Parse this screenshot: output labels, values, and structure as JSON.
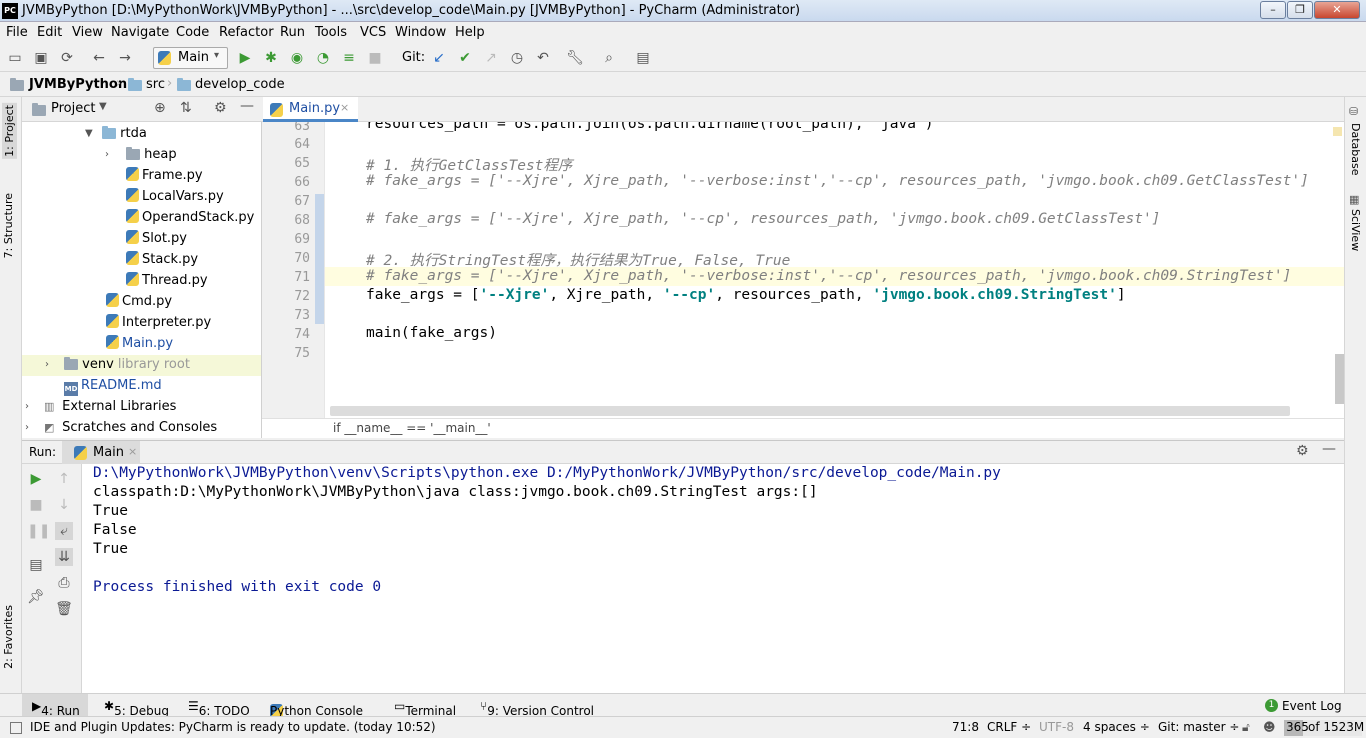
{
  "window": {
    "title": "JVMByPython [D:\\MyPythonWork\\JVMByPython] - ...\\src\\develop_code\\Main.py [JVMByPython] - PyCharm (Administrator)",
    "app_badge": "PC",
    "minimize": "–",
    "maximize": "❐",
    "close": "✕"
  },
  "menu": [
    "File",
    "Edit",
    "View",
    "Navigate",
    "Code",
    "Refactor",
    "Run",
    "Tools",
    "VCS",
    "Window",
    "Help"
  ],
  "toolbar": {
    "run_config": "Main",
    "git_label": "Git:"
  },
  "breadcrumb": [
    "JVMByPython",
    "src",
    "develop_code"
  ],
  "left_tabs": {
    "project": "1: Project",
    "structure": "7: Structure",
    "favorites": "2: Favorites"
  },
  "right_tabs": {
    "database": "Database",
    "sciview": "SciView"
  },
  "project_panel": {
    "title": "Project",
    "tree": [
      {
        "label": "rtda"
      },
      {
        "label": "heap"
      },
      {
        "label": "Frame.py"
      },
      {
        "label": "LocalVars.py"
      },
      {
        "label": "OperandStack.py"
      },
      {
        "label": "Slot.py"
      },
      {
        "label": "Stack.py"
      },
      {
        "label": "Thread.py"
      },
      {
        "label": "Cmd.py"
      },
      {
        "label": "Interpreter.py"
      },
      {
        "label": "Main.py"
      },
      {
        "label": "venv",
        "hint": "library root"
      },
      {
        "label": "README.md",
        "badge": "MD"
      },
      {
        "label": "External Libraries"
      },
      {
        "label": "Scratches and Consoles"
      }
    ]
  },
  "editor": {
    "tab": "Main.py",
    "lines": [
      {
        "num": "63",
        "text": "resources_path = os.path.join(os.path.dirname(root_path), 'java')"
      },
      {
        "num": "64",
        "text": ""
      },
      {
        "num": "65",
        "text": "# 1. 执行GetClassTest程序"
      },
      {
        "num": "66",
        "text": "# fake_args = ['--Xjre', Xjre_path, '--verbose:inst','--cp', resources_path, 'jvmgo.book.ch09.GetClassTest']"
      },
      {
        "num": "67",
        "text": ""
      },
      {
        "num": "68",
        "text": "# fake_args = ['--Xjre', Xjre_path, '--cp', resources_path, 'jvmgo.book.ch09.GetClassTest']"
      },
      {
        "num": "69",
        "text": ""
      },
      {
        "num": "70",
        "text": "# 2. 执行StringTest程序，执行结果为True, False, True"
      },
      {
        "num": "71",
        "text": "# fake_args = ['--Xjre', Xjre_path, '--verbose:inst','--cp', resources_path, 'jvmgo.book.ch09.StringTest']"
      },
      {
        "num": "72",
        "pre": "fake_args = [",
        "s1": "'--Xjre'",
        "mid1": ", Xjre_path, ",
        "s2": "'--cp'",
        "mid2": ", resources_path, ",
        "s3": "'jvmgo.book.ch09.StringTest'",
        "post": "]"
      },
      {
        "num": "73",
        "text": ""
      },
      {
        "num": "74",
        "text": "main(fake_args)"
      },
      {
        "num": "75",
        "text": ""
      }
    ],
    "breadcrumb": "if __name__ == '__main__'"
  },
  "run_panel": {
    "label": "Run:",
    "tab": "Main",
    "output": [
      "D:\\MyPythonWork\\JVMByPython\\venv\\Scripts\\python.exe D:/MyPythonWork/JVMByPython/src/develop_code/Main.py",
      "classpath:D:\\MyPythonWork\\JVMByPython\\java class:jvmgo.book.ch09.StringTest args:[]",
      "True",
      "False",
      "True",
      "",
      "Process finished with exit code 0"
    ]
  },
  "tool_windows": [
    "4: Run",
    "5: Debug",
    "6: TODO",
    "Python Console",
    "Terminal",
    "9: Version Control",
    "Event Log"
  ],
  "event_log_count": "1",
  "status": {
    "message": "IDE and Plugin Updates: PyCharm is ready to update. (today 10:52)",
    "position": "71:8",
    "line_sep": "CRLF ÷",
    "encoding": "UTF-8",
    "indent": "4 spaces ÷",
    "vcs": "Git: master ÷",
    "memory_used": "365",
    "memory_total": "of 1523M",
    "memory_fraction": 0.24
  },
  "colors": {
    "accent_blue": "#1f4fa3",
    "console_blue": "#0b1a94",
    "string_teal": "#008080"
  }
}
